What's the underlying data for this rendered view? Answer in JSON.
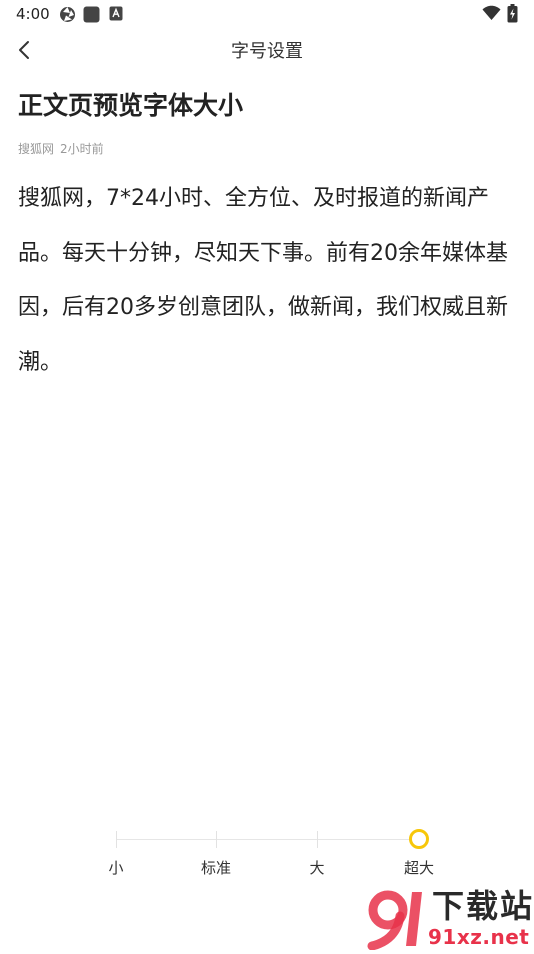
{
  "status_bar": {
    "time": "4:00"
  },
  "header": {
    "title": "字号设置"
  },
  "article": {
    "title": "正文页预览字体大小",
    "source": "搜狐网",
    "time": "2小时前",
    "body": "搜狐网，7*24小时、全方位、及时报道的新闻产品。每天十分钟，尽知天下事。前有20余年媒体基因，后有20多岁创意团队，做新闻，我们权威且新潮。"
  },
  "font_size_slider": {
    "options": [
      "小",
      "标准",
      "大",
      "超大"
    ],
    "selected": "超大",
    "accent_color": "#f7c70a"
  },
  "watermark": {
    "text_top": "下载站",
    "text_bottom": "91xz.net",
    "logo_color": "#e8324a"
  }
}
